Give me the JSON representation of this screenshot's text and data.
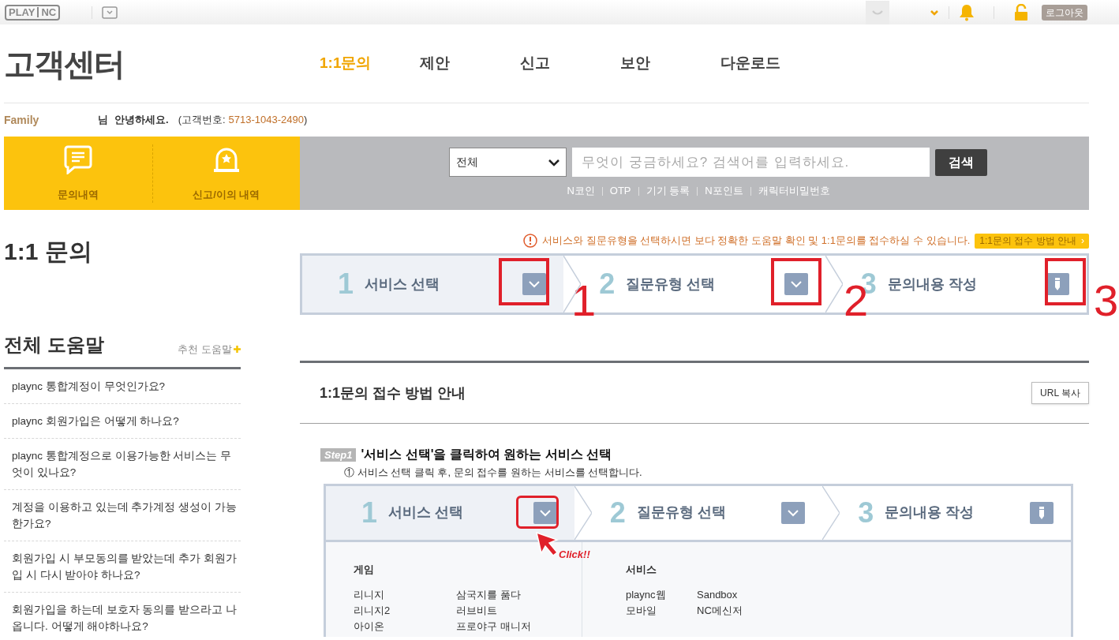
{
  "topbar": {
    "logo": [
      "PLAY",
      "NC"
    ],
    "logout": "로그아웃"
  },
  "header": {
    "title": "고객센터",
    "nav": [
      {
        "label": "1:1문의",
        "selected": true
      },
      {
        "label": "제안",
        "selected": false
      },
      {
        "label": "신고",
        "selected": false
      },
      {
        "label": "보안",
        "selected": false
      },
      {
        "label": "다운로드",
        "selected": false
      }
    ]
  },
  "greeting": {
    "grade": "Family",
    "name_suffix": "님",
    "text": "안녕하세요.",
    "customer_no_label": "(고객번호:",
    "customer_no": "5713-1043-2490",
    "close": ")"
  },
  "quick_links": [
    {
      "label": "문의내역",
      "kind": "chat"
    },
    {
      "label": "신고/이의 내역",
      "kind": "alarm"
    }
  ],
  "search": {
    "category": "전체",
    "placeholder": "무엇이 궁금하세요? 검색어를 입력하세요.",
    "button": "검색",
    "links": [
      "N코인",
      "OTP",
      "기기 등록",
      "N포인트",
      "캐릭터비밀번호"
    ]
  },
  "page_title": "1:1 문의",
  "help": {
    "title": "전체 도움말",
    "more": "추천 도움말",
    "items": [
      "plaync 통합계정이 무엇인가요?",
      "plaync 회원가입은 어떻게 하나요?",
      "plaync 통합계정으로 이용가능한 서비스는 무엇이 있나요?",
      "계정을 이용하고 있는데 추가계정 생성이 가능한가요?",
      "회원가입 시 부모동의를 받았는데 추가 회원가입 시 다시 받아야 하나요?",
      "회원가입을 하는데 보호자 동의를 받으라고 나옵니다. 어떻게 해야하나요?"
    ]
  },
  "notice": {
    "text": "서비스와 질문유형을 선택하시면 보다 정확한 도움말 확인 및 1:1문의를 접수하실 수 있습니다.",
    "guide_button": "1:1문의 접수 방법 안내",
    "guide_arrow": "›"
  },
  "steps": [
    {
      "number": "1",
      "label": "서비스 선택",
      "kind": "dropdown"
    },
    {
      "number": "2",
      "label": "질문유형 선택",
      "kind": "dropdown"
    },
    {
      "number": "3",
      "label": "문의내용 작성",
      "kind": "write"
    }
  ],
  "annotations": [
    "1",
    "2",
    "3"
  ],
  "guide": {
    "title": "1:1문의 접수 방법 안내",
    "copy_button": "URL 복사",
    "step_badge": "Step1",
    "step_title": "'서비스 선택'을 클릭하여 원하는 서비스 선택",
    "step_desc": "① 서비스 선택 클릭 후, 문의 접수를 원하는 서비스를 선택합니다.",
    "click_label": "Click!!",
    "example_steps": [
      {
        "number": "1",
        "label": "서비스 선택",
        "kind": "dropdown"
      },
      {
        "number": "2",
        "label": "질문유형 선택",
        "kind": "dropdown"
      },
      {
        "number": "3",
        "label": "문의내용 작성",
        "kind": "write"
      }
    ],
    "menu": [
      {
        "heading": "게임",
        "items": [
          "리니지",
          "삼국지를 품다",
          "리니지2",
          "러브비트",
          "아이온",
          "프로야구 매니저"
        ]
      },
      {
        "heading": "서비스",
        "items": [
          "plaync웹",
          "Sandbox",
          "모바일",
          "NC메신저"
        ]
      }
    ]
  }
}
